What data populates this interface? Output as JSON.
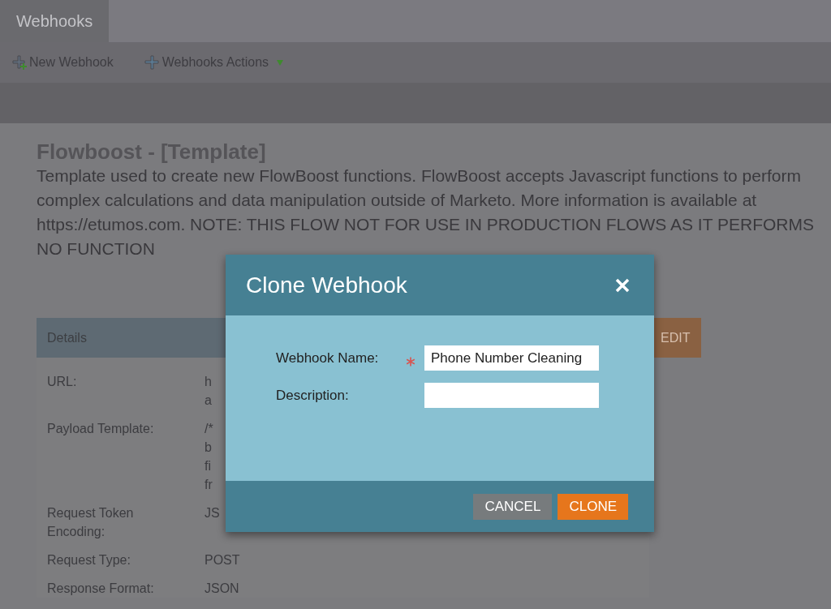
{
  "tabs": [
    {
      "label": "Webhooks",
      "selected": true
    }
  ],
  "toolbar": [
    {
      "label": "New Webhook",
      "kind": "new"
    },
    {
      "label": "Webhooks Actions",
      "kind": "menu"
    }
  ],
  "page": {
    "title": "Flowboost - [Template]",
    "description": "Template used to create new FlowBoost functions. FlowBoost accepts Javascript functions to perform complex calculations and data manipulation outside of Marketo. More information is available at https://etumos.com. NOTE: THIS FLOW NOT FOR USE IN PRODUCTION FLOWS AS IT PERFORMS NO FUNCTION"
  },
  "details": {
    "header": "Details",
    "edit_button": "EDIT",
    "rows": [
      {
        "label": "URL:",
        "value": [
          "h",
          "a"
        ]
      },
      {
        "label": "Payload Template:",
        "value": [
          "/*",
          "b",
          "fi",
          "fr"
        ]
      },
      {
        "label": "Request Token Encoding:",
        "value": [
          "JS"
        ]
      },
      {
        "label": "Request Type:",
        "value": [
          "POST"
        ]
      },
      {
        "label": "Response Format:",
        "value": [
          "JSON"
        ]
      }
    ]
  },
  "modal": {
    "title": "Clone Webhook",
    "fields": [
      {
        "label": "Webhook Name:",
        "required": true,
        "value": "Phone Number Cleaning"
      },
      {
        "label": "Description:",
        "required": false
      }
    ],
    "buttons": [
      {
        "label": "CANCEL",
        "kind": "secondary"
      },
      {
        "label": "CLONE",
        "kind": "primary"
      }
    ]
  }
}
